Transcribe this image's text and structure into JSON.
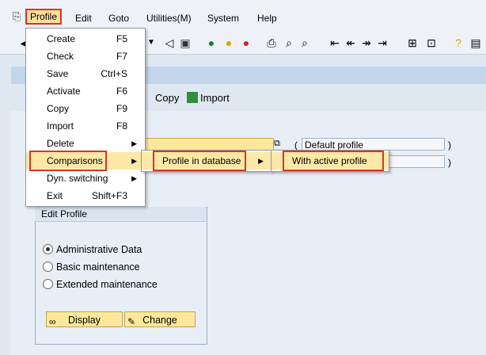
{
  "menubar": {
    "items": [
      {
        "label": "Profile"
      },
      {
        "label": "Edit"
      },
      {
        "label": "Goto"
      },
      {
        "label": "Utilities(M)"
      },
      {
        "label": "System"
      },
      {
        "label": "Help"
      }
    ]
  },
  "toolbar": {
    "icons": [
      "back-icon",
      "save-icon",
      "back-arrow-icon",
      "exit-icon",
      "cancel-icon",
      "print-icon",
      "find-icon",
      "find-next-icon",
      "first-page-icon",
      "prev-page-icon",
      "next-page-icon",
      "last-page-icon",
      "new-session-icon",
      "shortcut-icon",
      "help-icon",
      "layout-icon"
    ]
  },
  "app_toolbar": {
    "copy_label": "Copy",
    "import_label": "Import"
  },
  "fields": {
    "default_profile": "Default profile"
  },
  "edit_profile": {
    "title": "Edit Profile",
    "options": [
      {
        "label": "Administrative Data",
        "selected": true
      },
      {
        "label": "Basic maintenance",
        "selected": false
      },
      {
        "label": "Extended maintenance",
        "selected": false
      }
    ],
    "display_label": "Display",
    "change_label": "Change"
  },
  "profile_menu": {
    "items": [
      {
        "label": "Create",
        "shortcut": "F5"
      },
      {
        "label": "Check",
        "shortcut": "F7"
      },
      {
        "label": "Save",
        "shortcut": "Ctrl+S"
      },
      {
        "label": "Activate",
        "shortcut": "F6"
      },
      {
        "label": "Copy",
        "shortcut": "F9"
      },
      {
        "label": "Import",
        "shortcut": "F8"
      },
      {
        "label": "Delete",
        "shortcut": ""
      },
      {
        "label": "Comparisons",
        "shortcut": ""
      },
      {
        "label": "Dyn. switching",
        "shortcut": ""
      },
      {
        "label": "Exit",
        "shortcut": "Shift+F3"
      }
    ]
  },
  "comparisons_menu": {
    "items": [
      {
        "label": "Profile in database"
      }
    ]
  },
  "profile_in_database_menu": {
    "items": [
      {
        "label": "With active profile"
      }
    ]
  },
  "colors": {
    "highlight": "#d9342b",
    "selected_bg": "#fde8a8"
  }
}
